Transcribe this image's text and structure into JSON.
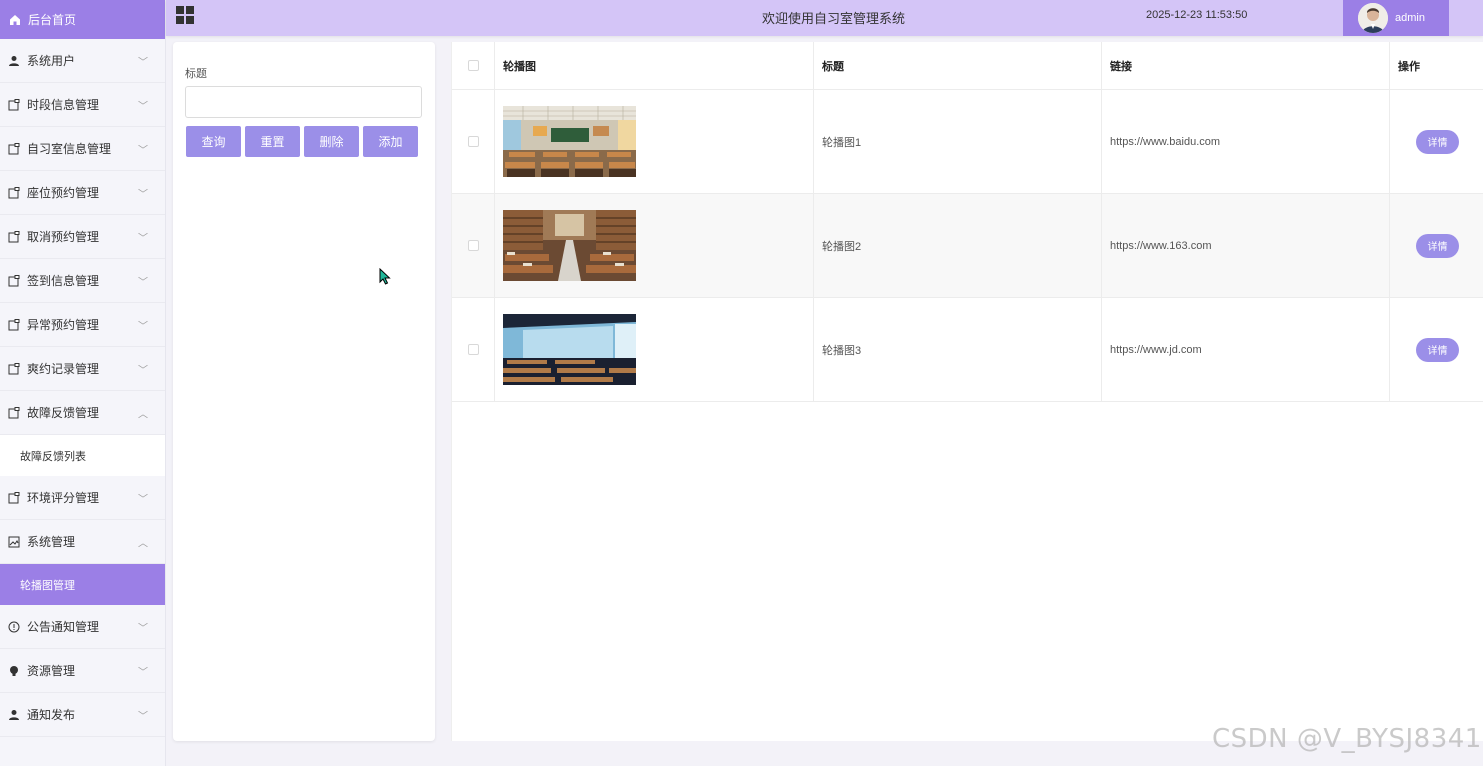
{
  "sidebar": {
    "home_label": "后台首页",
    "items": [
      {
        "label": "系统用户",
        "icon": "user-icon",
        "expanded": false
      },
      {
        "label": "时段信息管理",
        "icon": "folder-icon",
        "expanded": false
      },
      {
        "label": "自习室信息管理",
        "icon": "folder-icon",
        "expanded": false
      },
      {
        "label": "座位预约管理",
        "icon": "folder-icon",
        "expanded": false
      },
      {
        "label": "取消预约管理",
        "icon": "folder-icon",
        "expanded": false
      },
      {
        "label": "签到信息管理",
        "icon": "folder-icon",
        "expanded": false
      },
      {
        "label": "异常预约管理",
        "icon": "folder-icon",
        "expanded": false
      },
      {
        "label": "爽约记录管理",
        "icon": "folder-icon",
        "expanded": false
      },
      {
        "label": "故障反馈管理",
        "icon": "folder-icon",
        "expanded": true
      },
      {
        "label": "环境评分管理",
        "icon": "folder-icon",
        "expanded": false
      },
      {
        "label": "系统管理",
        "icon": "image-icon",
        "expanded": true
      },
      {
        "label": "公告通知管理",
        "icon": "info-icon",
        "expanded": false
      },
      {
        "label": "资源管理",
        "icon": "bulb-icon",
        "expanded": false
      },
      {
        "label": "通知发布",
        "icon": "user-icon",
        "expanded": false
      }
    ],
    "sub_fault_list": "故障反馈列表",
    "sub_carousel": "轮播图管理"
  },
  "header": {
    "title": "欢迎使用自习室管理系统",
    "datetime": "2025-12-23 11:53:50",
    "username": "admin"
  },
  "search": {
    "label": "标题",
    "value": "",
    "buttons": {
      "query": "查询",
      "reset": "重置",
      "delete": "删除",
      "add": "添加"
    }
  },
  "table": {
    "headers": {
      "image": "轮播图",
      "title": "标题",
      "link": "链接",
      "op": "操作"
    },
    "rows": [
      {
        "title": "轮播图1",
        "link": "https://www.baidu.com",
        "action": "详情"
      },
      {
        "title": "轮播图2",
        "link": "https://www.163.com",
        "action": "详情"
      },
      {
        "title": "轮播图3",
        "link": "https://www.jd.com",
        "action": "详情"
      }
    ]
  },
  "watermark": "CSDN @V_BYSJ8341",
  "colors": {
    "accent": "#9b7fe6",
    "header_bg": "#d4c5f7",
    "button": "#9b8fe8"
  }
}
